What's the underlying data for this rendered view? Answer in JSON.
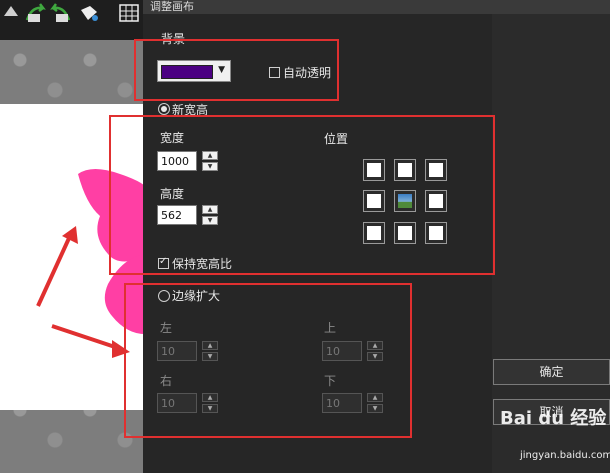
{
  "dialog": {
    "title": "调整画布",
    "background_label": "背景",
    "background_color": "#4b0082",
    "auto_transparent_label": "自动透明",
    "auto_transparent_checked": false,
    "new_size_label": "新宽高",
    "width_label": "宽度",
    "width_value": "1000",
    "height_label": "高度",
    "height_value": "562",
    "position_label": "位置",
    "keep_ratio_label": "保持宽高比",
    "keep_ratio_checked": true,
    "edge_expand_label": "边缘扩大",
    "left_label": "左",
    "left_value": "10",
    "top_label": "上",
    "top_value": "10",
    "right_label": "右",
    "right_value": "10",
    "bottom_label": "下",
    "bottom_value": "10",
    "ok_label": "确定",
    "cancel_label": "取消"
  },
  "watermark": {
    "brand": "Bai du 经验",
    "url": "jingyan.baidu.com"
  },
  "colors": {
    "annotation_red": "#e03030",
    "butterfly_pink": "#ff3fa4"
  }
}
